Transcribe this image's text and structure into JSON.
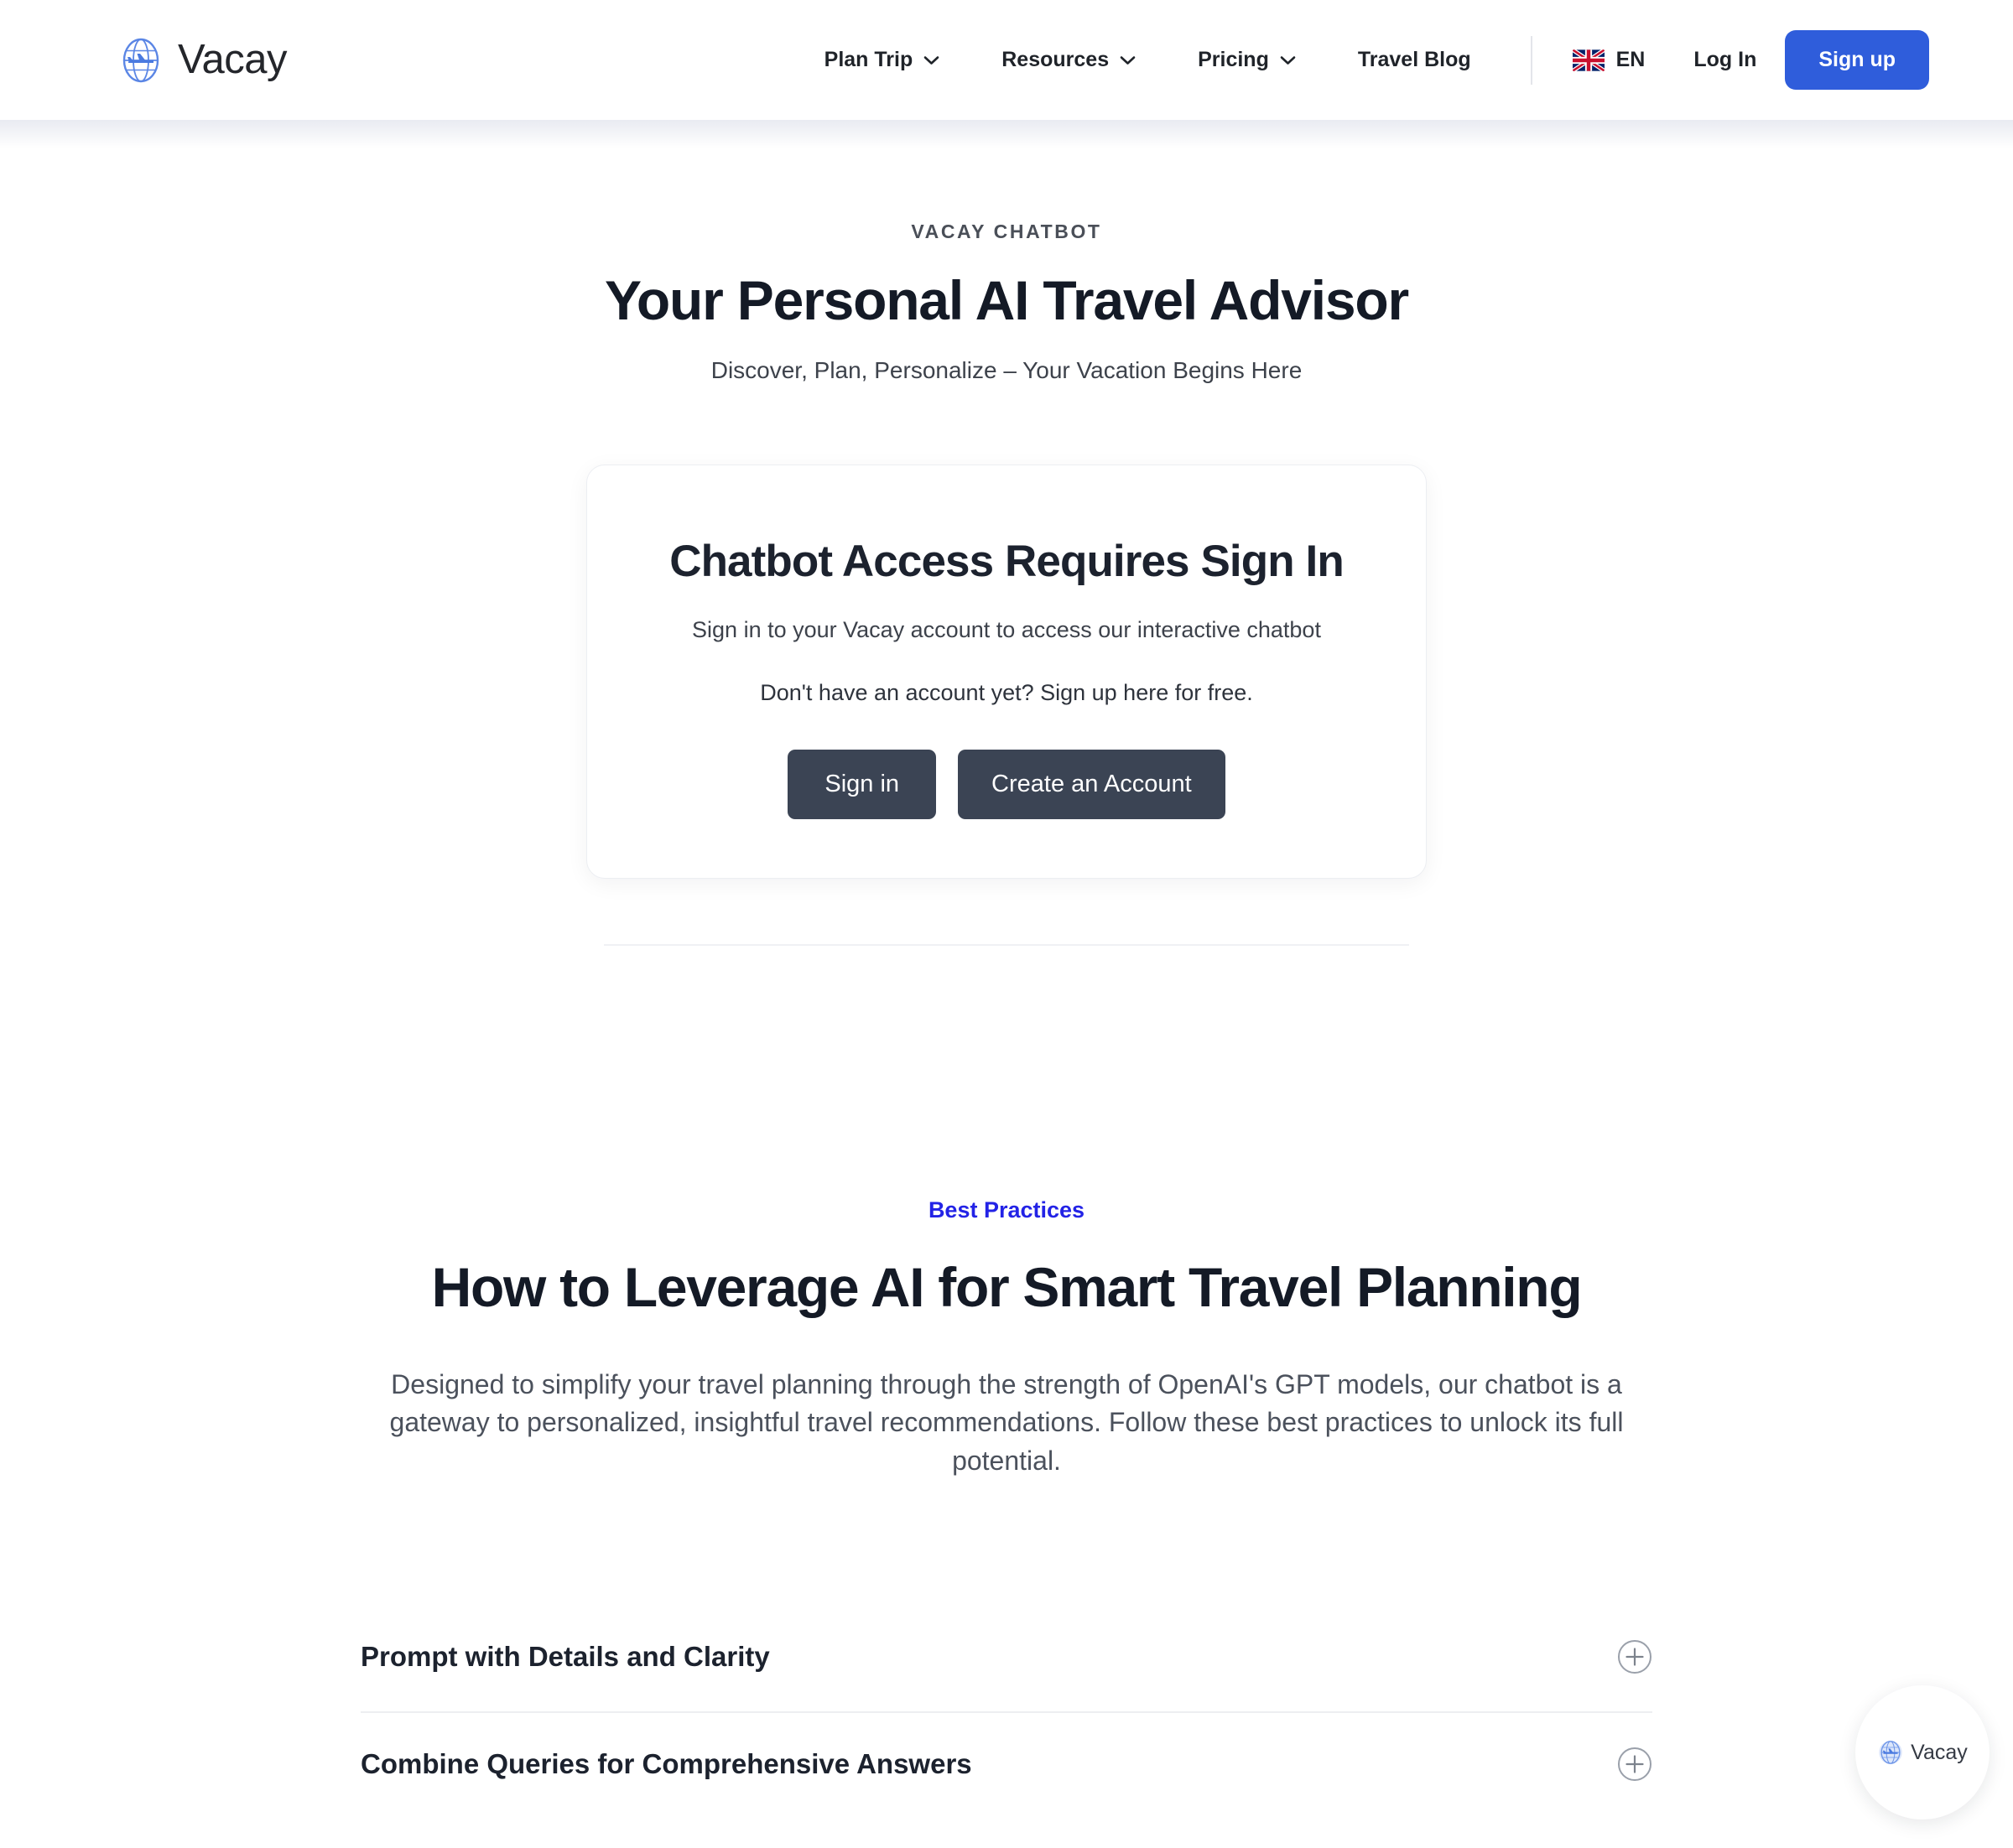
{
  "header": {
    "brand": {
      "name": "Vacay",
      "logo_icon": "globe-plane-icon"
    },
    "nav": [
      {
        "label": "Plan Trip",
        "has_dropdown": true
      },
      {
        "label": "Resources",
        "has_dropdown": true
      },
      {
        "label": "Pricing",
        "has_dropdown": true
      },
      {
        "label": "Travel Blog",
        "has_dropdown": false
      }
    ],
    "language": {
      "code": "EN",
      "flag_icon": "uk-flag-icon"
    },
    "login_label": "Log In",
    "signup_label": "Sign up",
    "accent_color": "#2f5ddb"
  },
  "hero": {
    "eyebrow": "VACAY CHATBOT",
    "title": "Your Personal AI Travel Advisor",
    "subtitle": "Discover, Plan, Personalize – Your Vacation Begins Here"
  },
  "signin_card": {
    "title": "Chatbot Access Requires Sign In",
    "subtitle": "Sign in to your Vacay account to access our interactive chatbot",
    "note": "Don't have an account yet? Sign up here for free.",
    "primary_button": "Sign in",
    "secondary_button": "Create an Account",
    "button_color": "#3b4454"
  },
  "practices": {
    "tag": "Best Practices",
    "tag_color": "#2323e6",
    "title": "How to Leverage AI for Smart Travel Planning",
    "body": "Designed to simplify your travel planning through the strength of OpenAI's GPT models, our chatbot is a gateway to personalized, insightful travel recommendations. Follow these best practices to unlock its full potential."
  },
  "accordion": {
    "items": [
      {
        "label": "Prompt with Details and Clarity",
        "toggle_icon": "plus-circle-icon"
      },
      {
        "label": "Combine Queries for Comprehensive Answers",
        "toggle_icon": "plus-circle-icon"
      }
    ]
  },
  "chat_widget": {
    "label": "Vacay",
    "icon": "globe-plane-icon"
  }
}
